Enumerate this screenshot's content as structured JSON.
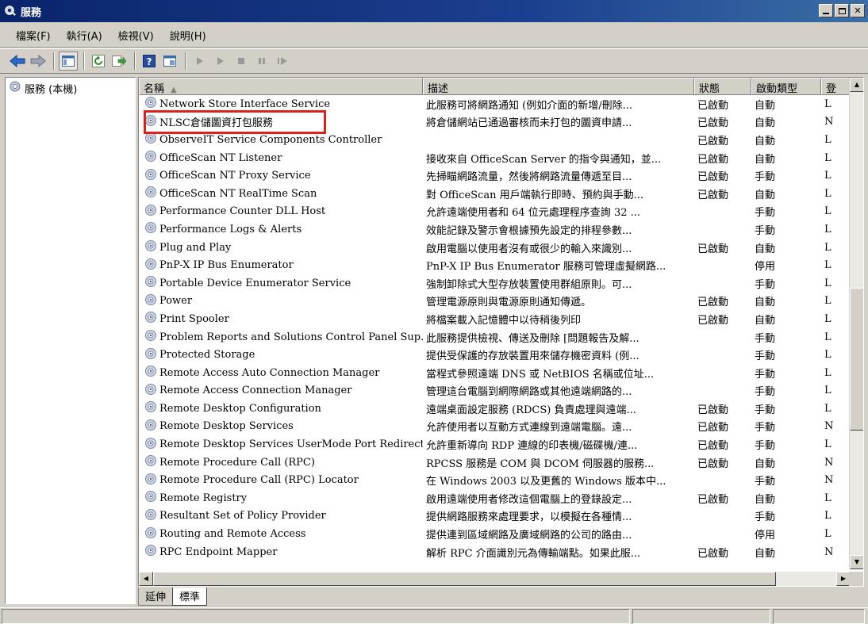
{
  "window": {
    "title": "服務"
  },
  "menu": [
    "檔案(F)",
    "執行(A)",
    "檢視(V)",
    "說明(H)"
  ],
  "tree": {
    "root": "服務 (本機)"
  },
  "columns": {
    "name": "名稱",
    "description": "描述",
    "status": "狀態",
    "startup": "啟動類型",
    "logon": "登"
  },
  "rows": [
    {
      "name": "Network Store Interface Service",
      "description": "此服務可將網路通知 (例如介面的新增/刪除...",
      "status": "已啟動",
      "startup": "自動",
      "logon": "L"
    },
    {
      "name": "NLSC倉儲圖資打包服務",
      "description": "將倉儲網站已通過審核而未打包的圖資申請...",
      "status": "已啟動",
      "startup": "自動",
      "logon": "N"
    },
    {
      "name": "ObserveIT Service Components Controller",
      "description": "",
      "status": "已啟動",
      "startup": "自動",
      "logon": "L"
    },
    {
      "name": "OfficeScan NT Listener",
      "description": "接收來自 OfficeScan Server 的指令與通知，並...",
      "status": "已啟動",
      "startup": "自動",
      "logon": "L"
    },
    {
      "name": "OfficeScan NT Proxy Service",
      "description": "先掃瞄網路流量，然後將網路流量傳遞至目...",
      "status": "已啟動",
      "startup": "手動",
      "logon": "L"
    },
    {
      "name": "OfficeScan NT RealTime Scan",
      "description": "對 OfficeScan 用戶端執行即時、預約與手動...",
      "status": "已啟動",
      "startup": "自動",
      "logon": "L"
    },
    {
      "name": "Performance Counter DLL Host",
      "description": "允許遠端使用者和 64 位元處理程序查詢 32 ...",
      "status": "",
      "startup": "手動",
      "logon": "L"
    },
    {
      "name": "Performance Logs & Alerts",
      "description": "效能記錄及警示會根據預先設定的排程參數...",
      "status": "",
      "startup": "手動",
      "logon": "L"
    },
    {
      "name": "Plug and Play",
      "description": "啟用電腦以使用者沒有或很少的輸入來識別...",
      "status": "已啟動",
      "startup": "自動",
      "logon": "L"
    },
    {
      "name": "PnP-X IP Bus Enumerator",
      "description": "PnP-X IP Bus Enumerator 服務可管理虛擬網路...",
      "status": "",
      "startup": "停用",
      "logon": "L"
    },
    {
      "name": "Portable Device Enumerator Service",
      "description": "強制卸除式大型存放裝置使用群組原則。可...",
      "status": "",
      "startup": "手動",
      "logon": "L"
    },
    {
      "name": "Power",
      "description": "管理電源原則與電源原則通知傳遞。",
      "status": "已啟動",
      "startup": "自動",
      "logon": "L"
    },
    {
      "name": "Print Spooler",
      "description": "將檔案載入記憶體中以待稍後列印",
      "status": "已啟動",
      "startup": "自動",
      "logon": "L"
    },
    {
      "name": "Problem Reports and Solutions Control Panel Sup...",
      "description": "此服務提供檢視、傳送及刪除 [問題報告及解...",
      "status": "",
      "startup": "手動",
      "logon": "L"
    },
    {
      "name": "Protected Storage",
      "description": "提供受保護的存放裝置用來儲存機密資料 (例...",
      "status": "",
      "startup": "手動",
      "logon": "L"
    },
    {
      "name": "Remote Access Auto Connection Manager",
      "description": "當程式參照遠端 DNS 或 NetBIOS 名稱或位址...",
      "status": "",
      "startup": "手動",
      "logon": "L"
    },
    {
      "name": "Remote Access Connection Manager",
      "description": "管理這台電腦到網際網路或其他遠端網路的...",
      "status": "",
      "startup": "手動",
      "logon": "L"
    },
    {
      "name": "Remote Desktop Configuration",
      "description": "遠端桌面設定服務 (RDCS) 負責處理與遠端...",
      "status": "已啟動",
      "startup": "手動",
      "logon": "L"
    },
    {
      "name": "Remote Desktop Services",
      "description": "允許使用者以互動方式連線到遠端電腦。遠...",
      "status": "已啟動",
      "startup": "手動",
      "logon": "N"
    },
    {
      "name": "Remote Desktop Services UserMode Port Redirector",
      "description": "允許重新導向 RDP 連線的印表機/磁碟機/連...",
      "status": "已啟動",
      "startup": "手動",
      "logon": "L"
    },
    {
      "name": "Remote Procedure Call (RPC)",
      "description": "RPCSS 服務是 COM 與 DCOM 伺服器的服務...",
      "status": "已啟動",
      "startup": "自動",
      "logon": "N"
    },
    {
      "name": "Remote Procedure Call (RPC) Locator",
      "description": "在 Windows 2003 以及更舊的 Windows 版本中...",
      "status": "",
      "startup": "手動",
      "logon": "N"
    },
    {
      "name": "Remote Registry",
      "description": "啟用遠端使用者修改這個電腦上的登錄設定...",
      "status": "已啟動",
      "startup": "自動",
      "logon": "L"
    },
    {
      "name": "Resultant Set of Policy Provider",
      "description": "提供網路服務來處理要求，以模擬在各種情...",
      "status": "",
      "startup": "手動",
      "logon": "L"
    },
    {
      "name": "Routing and Remote Access",
      "description": "提供連到區域網路及廣域網路的公司的路由...",
      "status": "",
      "startup": "停用",
      "logon": "L"
    },
    {
      "name": "RPC Endpoint Mapper",
      "description": "解析 RPC 介面識別元為傳輸端點。如果此服...",
      "status": "已啟動",
      "startup": "自動",
      "logon": "N"
    }
  ],
  "tabs": [
    "延伸",
    "標準"
  ]
}
